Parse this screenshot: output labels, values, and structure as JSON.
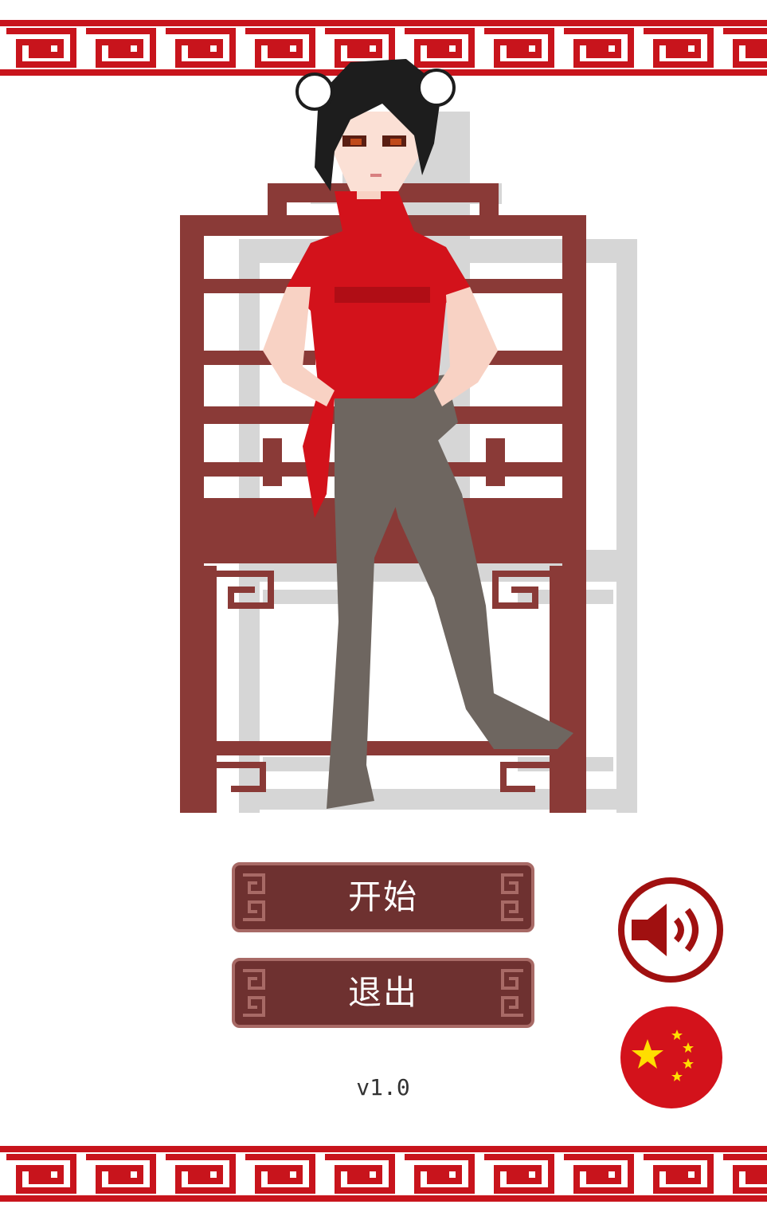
{
  "menu": {
    "start_label": "开始",
    "exit_label": "退出"
  },
  "version": "v1.0",
  "controls": {
    "sound_icon": "speaker-on-icon",
    "language_icon": "china-flag-icon"
  },
  "colors": {
    "border_red": "#c8141c",
    "chair_wood": "#8a3a37",
    "chair_wood_dark": "#6b2a28",
    "button_fill": "#6e3130",
    "button_edge": "#a86a66",
    "dress_red": "#d3121b",
    "stockings": "#6e6660",
    "hair": "#1d1d1d",
    "shadow": "#d6d6d6",
    "flag_star": "#ffde00"
  }
}
